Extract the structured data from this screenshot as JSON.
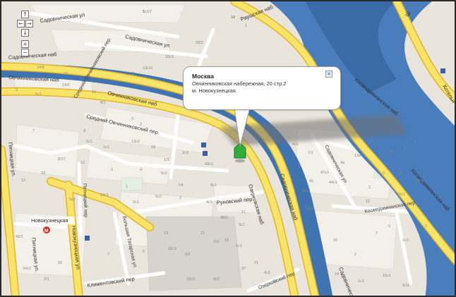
{
  "info_window": {
    "title": "Москва",
    "address": "Овчинниковская набережная, 20 стр.2",
    "metro": "м. Новокузнецкая",
    "close_icon": "close-x-icon"
  },
  "nav_controls": {
    "up": "↑",
    "left": "←",
    "right": "→",
    "down": "↓",
    "zoom_in": "+",
    "zoom_out": "−"
  },
  "street_labels": {
    "sadovnicheskaya_top": "Садовническая ул",
    "sadovnicheskaya_top2": "Садовническая ул",
    "sadovnicheskaya_nab": "Садовническая наб",
    "raushskaya_nab": "Раушская наб",
    "ovchinnikovskaya_nab_left": "Овчинниковская наб",
    "ovchinnikovskaya_nab": "Овчинниковская наб",
    "sredny_ovch": "Средний Овчинниковский пер.",
    "kosmodamianskaya_nab": "Космодамианская наб",
    "kosmodamianskaya_nab2": "Космодамианская наб",
    "kotel": "Котельн",
    "runovsky": "Руновский пер",
    "ozerkovskaya_nab": "Озерковская наб",
    "sadovnicheskaya_nab_right": "Садовническая наб",
    "sadovnicheskaya_ul_right": "Садовническая ул",
    "kosmodamianskaya_per": "Космодамианская пер",
    "pyatnitskaya": "Пятницкая ул.",
    "pyatnitskaya_low": "Пятницкая ул.",
    "pyatnitsky_per": "Пятницкий пер",
    "novokuznetskaya_ul": "Новокузнецкая ул",
    "bolshaya_tatarskaya": "Большая Татарская ул",
    "klimentovsky": "Климентовский пер",
    "ozerkovsky_per": "Озерковский пер",
    "sadovnicheskaya_bottom": "Садовническая",
    "novokuznetskaya_metro": "Новокузнецкая",
    "vodootvodny": "Ш"
  },
  "building_numbers": [
    "11/17",
    "12",
    "1",
    "33/2",
    "33с3",
    "13с11",
    "13с2",
    "24/8",
    "22",
    "3",
    "14/2",
    "5с1",
    "16",
    "8/1",
    "3",
    "2",
    "9",
    "7",
    "5с1",
    "1с1",
    "13с2",
    "18",
    "13",
    "1/3",
    "2с3",
    "4",
    "1",
    "5с2",
    "43с1",
    "7/4",
    "9с1",
    "10с1",
    "5с1",
    "2с1",
    "5с2",
    "2",
    "4с1",
    "38/2",
    "3с1",
    "11",
    "1с1",
    "21",
    "4с2",
    "12",
    "6с1",
    "7/1",
    "1",
    "41",
    "45с1",
    "47с1",
    "44с1",
    "4а",
    "13а",
    "15",
    "34",
    "17",
    "3",
    "1",
    "5",
    "26",
    "10с2",
    "15",
    "15с1",
    "13с3",
    "16",
    "2",
    "7",
    "6",
    "1с1",
    "2",
    "14",
    "1с1",
    "15с1",
    "9/11",
    "22с1",
    "6/2",
    "5",
    "13",
    "11",
    "7с1",
    "15с3",
    "4с2",
    "12",
    "37",
    "7",
    "26",
    "2/1",
    "34с2",
    "42/1",
    "10",
    "33",
    "8/17",
    "3",
    "5",
    "16"
  ],
  "markers": {
    "place_marker": "house-marker-icon",
    "metro_icon": "metro-icon",
    "bus_icon": "bus-stop-icon"
  },
  "colors": {
    "land": "#e9e5dc",
    "block": "#f2efe9",
    "block_dark": "#dedbd5",
    "river": "#3f74b0",
    "road_major": "#f7dd50",
    "road_minor": "#ffffff",
    "marker": "#2fae3a"
  }
}
